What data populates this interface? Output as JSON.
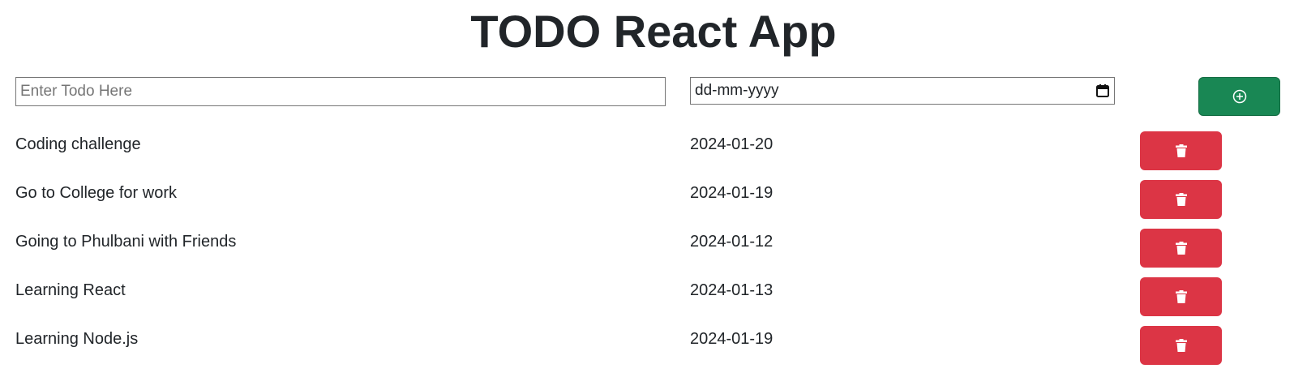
{
  "header": {
    "title": "TODO React App"
  },
  "form": {
    "todo_placeholder": "Enter Todo Here",
    "date_value": "dd-mm-yyyy",
    "add_icon": "plus-circle-icon",
    "calendar_icon": "calendar-icon"
  },
  "todos": [
    {
      "name": "Coding challenge",
      "date": "2024-01-20"
    },
    {
      "name": "Go to College for work",
      "date": "2024-01-19"
    },
    {
      "name": "Going to Phulbani with Friends",
      "date": "2024-01-12"
    },
    {
      "name": "Learning React",
      "date": "2024-01-13"
    },
    {
      "name": "Learning Node.js",
      "date": "2024-01-19"
    }
  ],
  "colors": {
    "add_button": "#198754",
    "delete_button": "#dc3545",
    "text": "#212529"
  },
  "icons": {
    "delete": "trash-icon"
  }
}
